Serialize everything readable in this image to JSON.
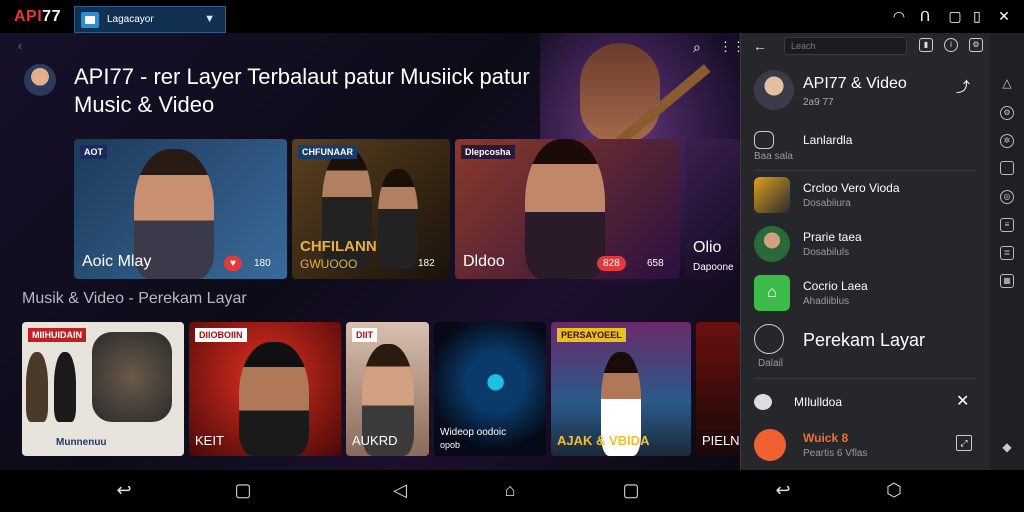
{
  "status": {
    "app_title_red": "API",
    "app_title_white": "77",
    "selector_label": "Lagacayor",
    "icons": [
      "wifi-icon",
      "headset-icon",
      "square-icon",
      "phone-icon",
      "close-icon"
    ]
  },
  "main": {
    "heading": "API77 - rer Layer Terbalaut patur Musiick patur Music & Video",
    "section_title": "Musik & Video - Perekam Layar",
    "cards": [
      {
        "tag": "AOT",
        "title": "Aoic Mlay",
        "badge": "",
        "num": "180",
        "bg": "#2d4a6b"
      },
      {
        "tag": "CHFUNAAR",
        "title": "CHFILANN",
        "title2": "GWUOOO",
        "num": "182",
        "bg": "#3a2a18"
      },
      {
        "tag": "Dlepcosha",
        "title": "Dldoo",
        "badge": "828",
        "num": "658",
        "bg": "#6a2a3a"
      },
      {
        "tag": "",
        "title": "Olio",
        "sub": "Dapoone",
        "bg": "#2a1a3a"
      }
    ],
    "thumbs": [
      {
        "tag": "MIIHUIDAIN",
        "title": "Munnenuu",
        "sub": "",
        "bg": "#e8e4dc"
      },
      {
        "tag": "DIIOBOIIN",
        "title": "KEIT",
        "bg": "#8a1010"
      },
      {
        "tag": "DIIT",
        "title": "AUKRD",
        "bg": "#d8c0b0"
      },
      {
        "tag": "",
        "title": "Wideop oodoic",
        "sub": "opob",
        "bg": "#0a1a2a"
      },
      {
        "tag": "PERSAYOEEL",
        "title": "AJAK & VBIDA",
        "bg": "#1a3a5a"
      },
      {
        "tag": "",
        "title": "PIELN",
        "bg": "#3a0a0a"
      }
    ]
  },
  "panel": {
    "search_placeholder": "Leach",
    "title": "API77 & Video",
    "subtitle": "2a9 77",
    "rows": [
      {
        "title": "Lanlardla",
        "sub": "Baa sala",
        "icon_color": "#26272b"
      },
      {
        "title": "Crcloo Vero Vioda",
        "sub": "Dosabiiura",
        "icon_color": "#333"
      },
      {
        "title": "Prarie taea",
        "sub": "Dosabiluls",
        "icon_color": "#1a6a3a"
      },
      {
        "title": "Cocrio Laea",
        "sub": "Ahadiiblus",
        "icon_color": "#3dbb4a"
      },
      {
        "title": "Perekam Layar",
        "sub": "Dalail",
        "icon_color": "#26272b"
      }
    ],
    "mini_player": {
      "title": "MIlulldoa"
    },
    "bottom_item": {
      "title": "Wuick 8",
      "sub": "Peartis 6 Vflas",
      "icon_color": "#f06030"
    }
  },
  "colors": {
    "accent": "#e8353b",
    "panel_bg": "#26272b",
    "selector_bg": "#12304f"
  }
}
